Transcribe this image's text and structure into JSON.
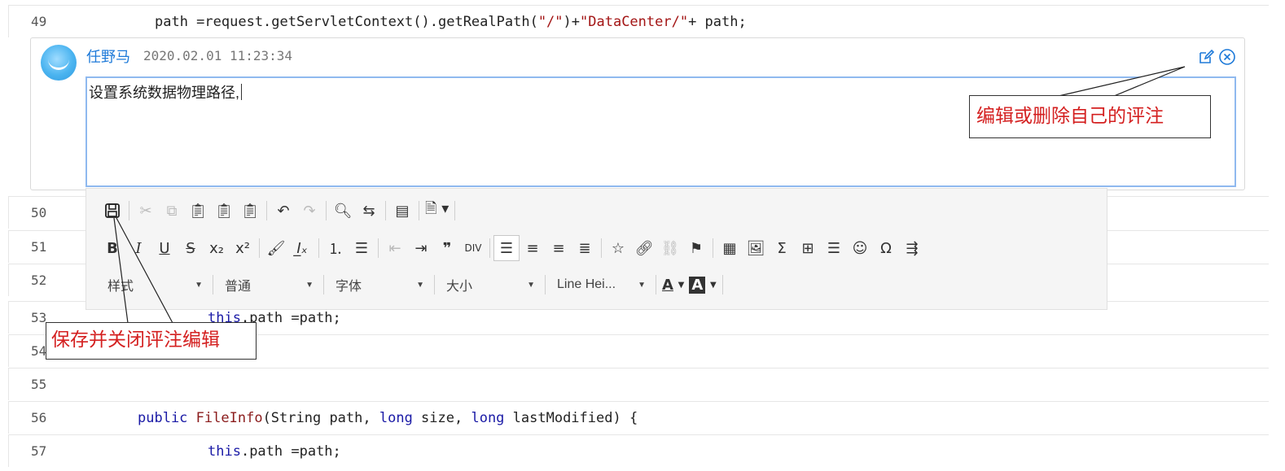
{
  "code_lines": [
    {
      "num": "49",
      "code": "path =request.getServletContext().getRealPath(\"/\")+\"DataCenter/\"+ path;"
    },
    {
      "num": "50"
    },
    {
      "num": "51"
    },
    {
      "num": "52"
    },
    {
      "num": "53",
      "kw": "this",
      "rest": ".path =path;"
    },
    {
      "num": "54"
    },
    {
      "num": "55"
    },
    {
      "num": "56",
      "p1": "public",
      "fn": "FileInfo",
      "p2": "(String path, ",
      "k2": "long",
      "p3": " size, ",
      "k3": "long",
      "p4": " lastModified) {"
    },
    {
      "num": "57",
      "kw": "this",
      "rest": ".path =path;"
    }
  ],
  "line49": {
    "a": "path =request.getServletContext().getRealPath(",
    "s1": "\"/\"",
    "b": ")+",
    "s2": "\"DataCenter/\"",
    "c": "+ path;"
  },
  "comment": {
    "author": "任野马",
    "time": "2020.02.01 11:23:34",
    "text": "设置系统数据物理路径,"
  },
  "toolbar": {
    "row3": {
      "style_label": "样式",
      "format_label": "普通",
      "font_label": "字体",
      "size_label": "大小",
      "line_height_label": "Line Hei..."
    }
  },
  "callouts": {
    "edit_delete": "编辑或删除自己的评注",
    "save_close": "保存并关闭评注编辑"
  },
  "colors": {
    "accent": "#1e7ad9",
    "callout_text": "#d42020",
    "editor_border": "#8fb9ef"
  }
}
